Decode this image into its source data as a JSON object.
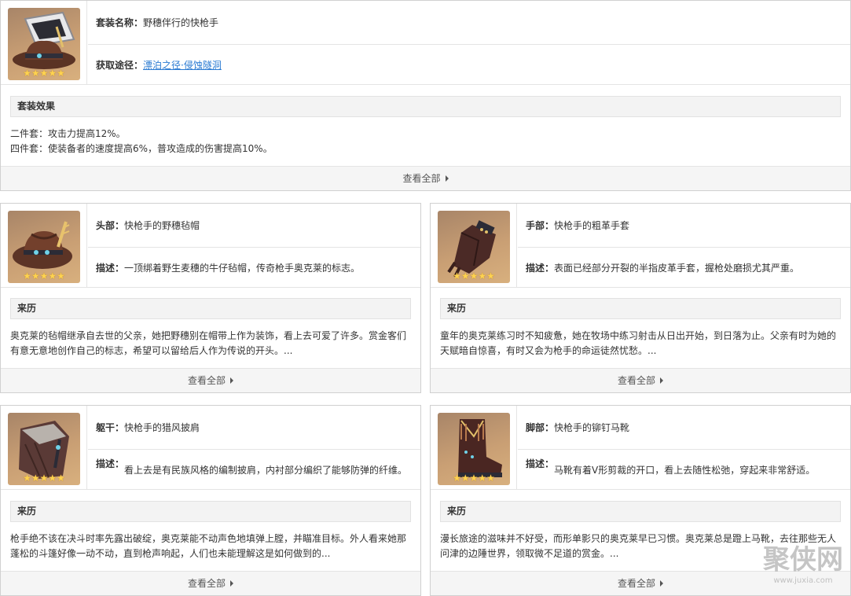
{
  "set": {
    "name_label": "套装名称：",
    "name_value": "野穗伴行的快枪手",
    "source_label": "获取途径：",
    "source_link": "漂泊之径·侵蚀隧洞",
    "effect_title": "套装效果",
    "effect_2": "二件套：攻击力提高12%。",
    "effect_4": "四件套：使装备者的速度提高6%，普攻造成的伤害提高10%。",
    "more_label": "查看全部",
    "stars": "★★★★★"
  },
  "pieces": [
    {
      "slot_label": "头部：",
      "name": "快枪手的野穗毡帽",
      "desc_label": "描述：",
      "desc": "一顶绑着野生麦穗的牛仔毡帽，传奇枪手奥克莱的标志。",
      "lore_title": "来历",
      "lore": "奥克莱的毡帽继承自去世的父亲，她把野穗别在帽带上作为装饰，看上去可爱了许多。赏金客们有意无意地创作自己的标志，希望可以留给后人作为传说的开头。...",
      "more_label": "查看全部",
      "stars": "★★★★★",
      "icon": "cowboy-hat-icon"
    },
    {
      "slot_label": "手部：",
      "name": "快枪手的粗革手套",
      "desc_label": "描述：",
      "desc": "表面已经部分开裂的半指皮革手套，握枪处磨损尤其严重。",
      "lore_title": "来历",
      "lore": "童年的奥克莱练习时不知疲惫，她在牧场中练习射击从日出开始，到日落为止。父亲有时为她的天赋暗自惊喜，有时又会为枪手的命运徒然忧愁。...",
      "more_label": "查看全部",
      "stars": "★★★★★",
      "icon": "leather-glove-icon"
    },
    {
      "slot_label": "躯干：",
      "name": "快枪手的猎风披肩",
      "desc_label": "描述：",
      "desc": "看上去是有民族风格的编制披肩，内衬部分编织了能够防弹的纤维。",
      "lore_title": "来历",
      "lore": "枪手绝不该在决斗时率先露出破绽，奥克莱能不动声色地填弹上膛，并瞄准目标。外人看来她那蓬松的斗篷好像一动不动，直到枪声响起，人们也未能理解这是如何做到的...",
      "more_label": "查看全部",
      "stars": "★★★★★",
      "icon": "poncho-cape-icon"
    },
    {
      "slot_label": "脚部：",
      "name": "快枪手的铆钉马靴",
      "desc_label": "描述：",
      "desc": "马靴有着V形剪裁的开口，看上去随性松弛，穿起来非常舒适。",
      "lore_title": "来历",
      "lore": "漫长旅途的滋味并不好受，而形单影只的奥克莱早已习惯。奥克莱总是蹬上马靴，去往那些无人问津的边陲世界，领取微不足道的赏金。...",
      "more_label": "查看全部",
      "stars": "★★★★★",
      "icon": "riding-boot-icon"
    }
  ],
  "watermark": {
    "text": "聚侠网",
    "url": "www.juxia.com"
  }
}
